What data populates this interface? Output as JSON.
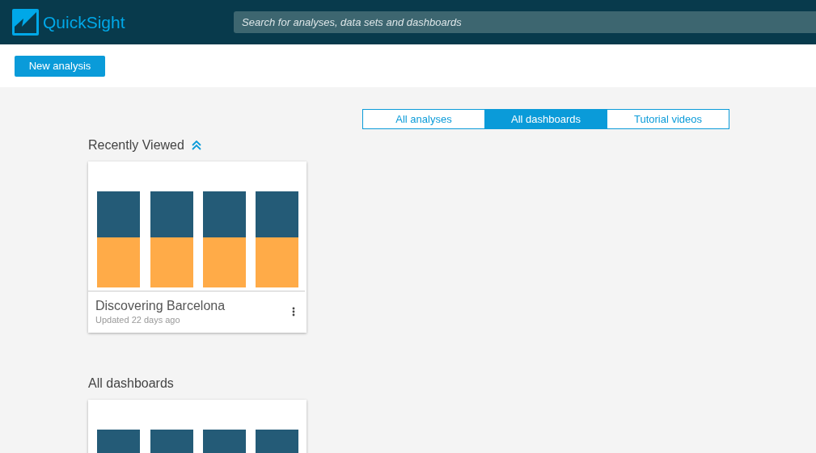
{
  "header": {
    "app_name": "QuickSight",
    "search": {
      "placeholder": "Search for analyses, data sets and dashboards"
    }
  },
  "toolbar": {
    "new_button": "New analysis"
  },
  "tabs": [
    {
      "label": "All analyses",
      "selected": false
    },
    {
      "label": "All dashboards",
      "selected": true
    },
    {
      "label": "Tutorial videos",
      "selected": false
    }
  ],
  "sections": [
    {
      "title": "Recently Viewed",
      "expanded": true,
      "cards": [
        {
          "kind": "dashboard",
          "title": "Discovering Barcelona",
          "subtitle": "Updated 22 days ago"
        }
      ]
    },
    {
      "title": "All dashboards",
      "cards": [
        {
          "kind": "dashboard"
        }
      ]
    }
  ]
}
